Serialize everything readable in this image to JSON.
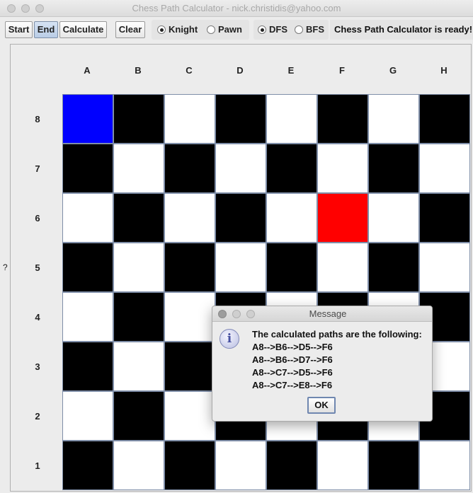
{
  "window": {
    "title": "Chess Path Calculator - nick.christidis@yahoo.com"
  },
  "toolbar": {
    "start_label": "Start",
    "end_label": "End",
    "calculate_label": "Calculate",
    "clear_label": "Clear",
    "piece_options": [
      {
        "label": "Knight",
        "selected": true
      },
      {
        "label": "Pawn",
        "selected": false
      }
    ],
    "search_options": [
      {
        "label": "DFS",
        "selected": true
      },
      {
        "label": "BFS",
        "selected": false
      }
    ],
    "status_text": "Chess Path Calculator is ready!"
  },
  "board": {
    "columns": [
      "A",
      "B",
      "C",
      "D",
      "E",
      "F",
      "G",
      "H"
    ],
    "rows": [
      "8",
      "7",
      "6",
      "5",
      "4",
      "3",
      "2",
      "1"
    ],
    "start_square": "A8",
    "end_square": "F6",
    "start_color": "#0000ff",
    "end_color": "#ff0000",
    "dark_color": "#000000",
    "light_color": "#ffffff",
    "side_mark": "?"
  },
  "dialog": {
    "title": "Message",
    "icon": "info-icon",
    "heading": "The calculated paths are the following:",
    "paths": [
      "A8-->B6-->D5-->F6",
      "A8-->B6-->D7-->F6",
      "A8-->C7-->D5-->F6",
      "A8-->C7-->E8-->F6"
    ],
    "ok_label": "OK"
  }
}
